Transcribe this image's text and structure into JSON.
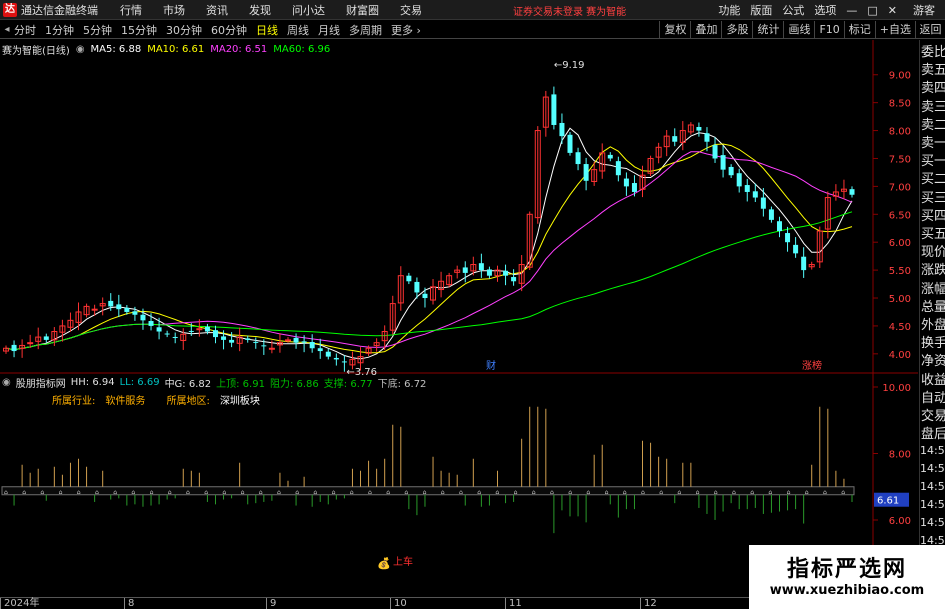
{
  "menubar": {
    "app_title": "通达信金融终端",
    "items": [
      "行情",
      "市场",
      "资讯",
      "发现",
      "问小达",
      "财富圈",
      "交易"
    ],
    "login_status": "证券交易未登录 赛为智能",
    "right_items": [
      "功能",
      "版面",
      "公式",
      "选项"
    ],
    "guest": "游客"
  },
  "periodbar": {
    "periods": [
      "分时",
      "1分钟",
      "5分钟",
      "15分钟",
      "30分钟",
      "60分钟",
      "日线",
      "周线",
      "月线",
      "多周期",
      "更多"
    ],
    "active_period": "日线",
    "tools": [
      "复权",
      "叠加",
      "多股",
      "统计",
      "画线",
      "F10",
      "标记",
      "+自选"
    ],
    "back": "返回"
  },
  "main_chart": {
    "title": "赛为智能(日线)",
    "ma": [
      {
        "label": "MA5: 6.88",
        "color": "#ffffff"
      },
      {
        "label": "MA10: 6.61",
        "color": "#ffff00"
      },
      {
        "label": "MA20: 6.51",
        "color": "#ff40ff"
      },
      {
        "label": "MA60: 6.96",
        "color": "#00ff00"
      }
    ],
    "y_ticks": [
      "9.00",
      "8.50",
      "8.00",
      "7.50",
      "7.00",
      "6.50",
      "6.00",
      "5.50",
      "5.00",
      "4.50",
      "4.00"
    ],
    "high_label": "9.19",
    "low_label": "3.76",
    "marker_cai": "财",
    "marker_zhangbang": "涨榜"
  },
  "indicator": {
    "title": "股朋指标网",
    "values": [
      {
        "label": "HH: 6.94",
        "color": "#e0e0e0"
      },
      {
        "label": "LL: 6.69",
        "color": "#00c0c0"
      },
      {
        "label": "中G: 6.82",
        "color": "#e0e0e0"
      },
      {
        "label": "上顶: 6.91",
        "color": "#00c000"
      },
      {
        "label": "阻力: 6.86",
        "color": "#00c000"
      },
      {
        "label": "支撑: 6.77",
        "color": "#00c000"
      },
      {
        "label": "下底: 6.72",
        "color": "#c0c0c0"
      }
    ],
    "industry_label": "所属行业:",
    "industry_value": "软件服务",
    "region_label": "所属地区:",
    "region_value": "深圳板块",
    "y_ticks": [
      "10.00",
      "8.00",
      "6.00"
    ],
    "current_value": "6.61",
    "signal_label": "上车"
  },
  "sidebar": {
    "tabs": [
      "委比",
      "卖五",
      "卖四",
      "卖三",
      "卖二",
      "卖一",
      "买一",
      "买二",
      "买三",
      "买四",
      "买五",
      "现价",
      "涨跌",
      "涨幅",
      "总量",
      "外盘",
      "换手",
      "净资",
      "收益",
      "自动",
      "交易",
      "盘后"
    ],
    "times": [
      "14:56",
      "14:56",
      "14:56",
      "14:56",
      "14:56",
      "14:56",
      "14:56",
      "14:56"
    ]
  },
  "x_axis": [
    "2024年",
    "8",
    "9",
    "10",
    "11",
    "12"
  ],
  "watermark": {
    "title": "指标严选网",
    "url": "www.xuezhibiao.com"
  },
  "chart_data": {
    "type": "candlestick",
    "ma5_last": 6.88,
    "ma10_last": 6.61,
    "ma20_last": 6.51,
    "ma60_last": 6.96,
    "ylim": [
      3.8,
      9.3
    ],
    "closes": [
      4.1,
      4.05,
      4.15,
      4.2,
      4.3,
      4.25,
      4.4,
      4.5,
      4.6,
      4.75,
      4.85,
      4.8,
      4.9,
      4.85,
      4.8,
      4.75,
      4.7,
      4.6,
      4.5,
      4.4,
      4.35,
      4.3,
      4.35,
      4.4,
      4.45,
      4.4,
      4.3,
      4.25,
      4.2,
      4.3,
      4.25,
      4.2,
      4.15,
      4.1,
      4.2,
      4.25,
      4.2,
      4.2,
      4.1,
      4.05,
      3.95,
      3.9,
      3.85,
      3.9,
      3.95,
      4.1,
      4.2,
      4.4,
      4.9,
      5.4,
      5.3,
      5.1,
      5.0,
      5.2,
      5.3,
      5.4,
      5.5,
      5.45,
      5.6,
      5.5,
      5.4,
      5.5,
      5.4,
      5.3,
      5.6,
      6.5,
      8.0,
      8.6,
      8.1,
      7.9,
      7.6,
      7.4,
      7.1,
      7.3,
      7.6,
      7.5,
      7.2,
      7.0,
      6.9,
      7.2,
      7.5,
      7.7,
      7.9,
      7.8,
      8.0,
      8.1,
      8.0,
      7.8,
      7.5,
      7.3,
      7.2,
      7.0,
      6.9,
      6.8,
      6.6,
      6.4,
      6.2,
      6.0,
      5.8,
      5.5,
      5.6,
      6.2,
      6.8,
      6.9,
      6.95,
      6.85
    ]
  }
}
